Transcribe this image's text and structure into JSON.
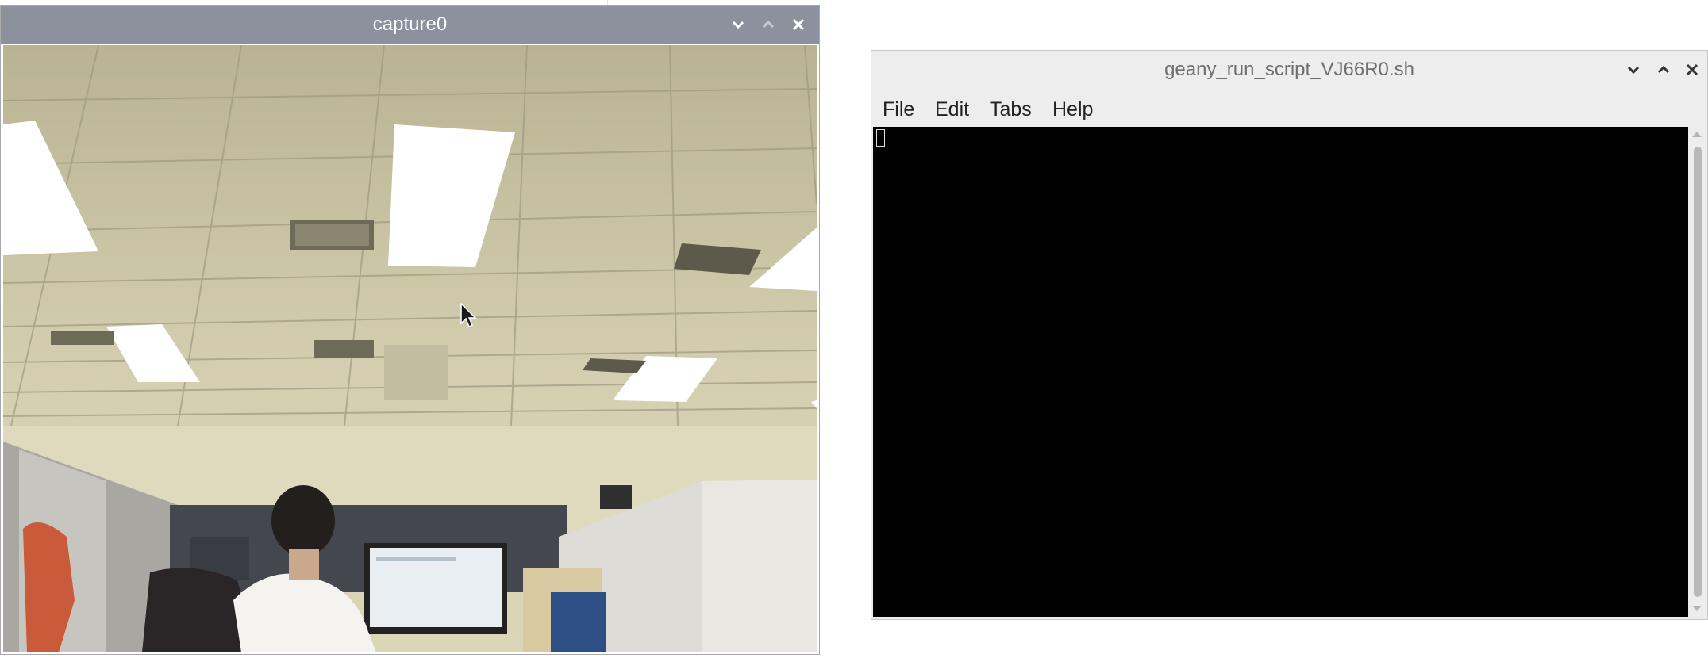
{
  "capture_window": {
    "title": "capture0",
    "titlebar_color": "#8c929d",
    "controls": [
      "chevron-down-icon",
      "chevron-up-icon",
      "close-icon"
    ]
  },
  "terminal_window": {
    "title": "geany_run_script_VJ66R0.sh",
    "menu": [
      "File",
      "Edit",
      "Tabs",
      "Help"
    ],
    "screen_color": "#000000",
    "controls": [
      "chevron-down-icon",
      "chevron-up-icon",
      "close-icon"
    ]
  }
}
